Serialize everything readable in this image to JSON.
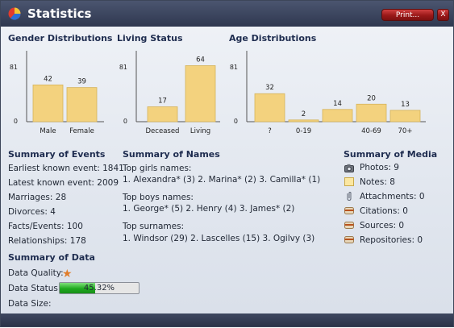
{
  "window": {
    "title": "Statistics",
    "print_label": "Print...",
    "close_label": "X"
  },
  "gender": {
    "heading": "Gender Distributions",
    "chart_data": {
      "type": "bar",
      "categories": [
        "Male",
        "Female"
      ],
      "values": [
        42,
        39
      ],
      "ylim": [
        0,
        81
      ],
      "yticks": [
        "0",
        "81"
      ]
    }
  },
  "living": {
    "heading": "Living Status",
    "chart_data": {
      "type": "bar",
      "categories": [
        "Deceased",
        "Living"
      ],
      "values": [
        17,
        64
      ],
      "ylim": [
        0,
        81
      ],
      "yticks": [
        "0",
        "81"
      ]
    }
  },
  "age": {
    "heading": "Age Distributions",
    "chart_data": {
      "type": "bar",
      "categories": [
        "?",
        "0-19",
        "",
        "40-69",
        "70+"
      ],
      "values": [
        32,
        2,
        14,
        20,
        13
      ],
      "ylim": [
        0,
        81
      ],
      "yticks": [
        "0",
        "81"
      ]
    }
  },
  "bar_color": "#f3d27e",
  "events": {
    "heading": "Summary of Events",
    "lines": [
      "Earliest known event: 1841",
      "Latest known event: 2009",
      "Marriages: 28",
      "Divorces: 4",
      "Facts/Events: 100",
      "Relationships: 178"
    ]
  },
  "names": {
    "heading": "Summary of Names",
    "girls_label": "Top girls names:",
    "girls": "1. Alexandra* (3) 2. Marina* (2) 3. Camilla* (1)",
    "boys_label": "Top boys names:",
    "boys": "1. George* (5) 2. Henry (4) 3. James* (2)",
    "surnames_label": "Top surnames:",
    "surnames": "1. Windsor (29) 2. Lascelles (15) 3. Ogilvy (3)"
  },
  "media": {
    "heading": "Summary of Media",
    "items": [
      {
        "icon": "camera-icon",
        "label": "Photos: 9"
      },
      {
        "icon": "note-icon",
        "label": "Notes: 8"
      },
      {
        "icon": "paperclip-icon",
        "label": "Attachments: 0"
      },
      {
        "icon": "citation-icon",
        "label": "Citations: 0"
      },
      {
        "icon": "source-icon",
        "label": "Sources: 0"
      },
      {
        "icon": "repository-icon",
        "label": "Repositories: 0"
      }
    ]
  },
  "data_summary": {
    "heading": "Summary of Data",
    "quality_label": "Data Quality:",
    "quality_icon": "star-icon",
    "status_label": "Data Status:",
    "status_percent": 45.32,
    "status_text": "45.32%",
    "size_label": "Data Size:"
  }
}
